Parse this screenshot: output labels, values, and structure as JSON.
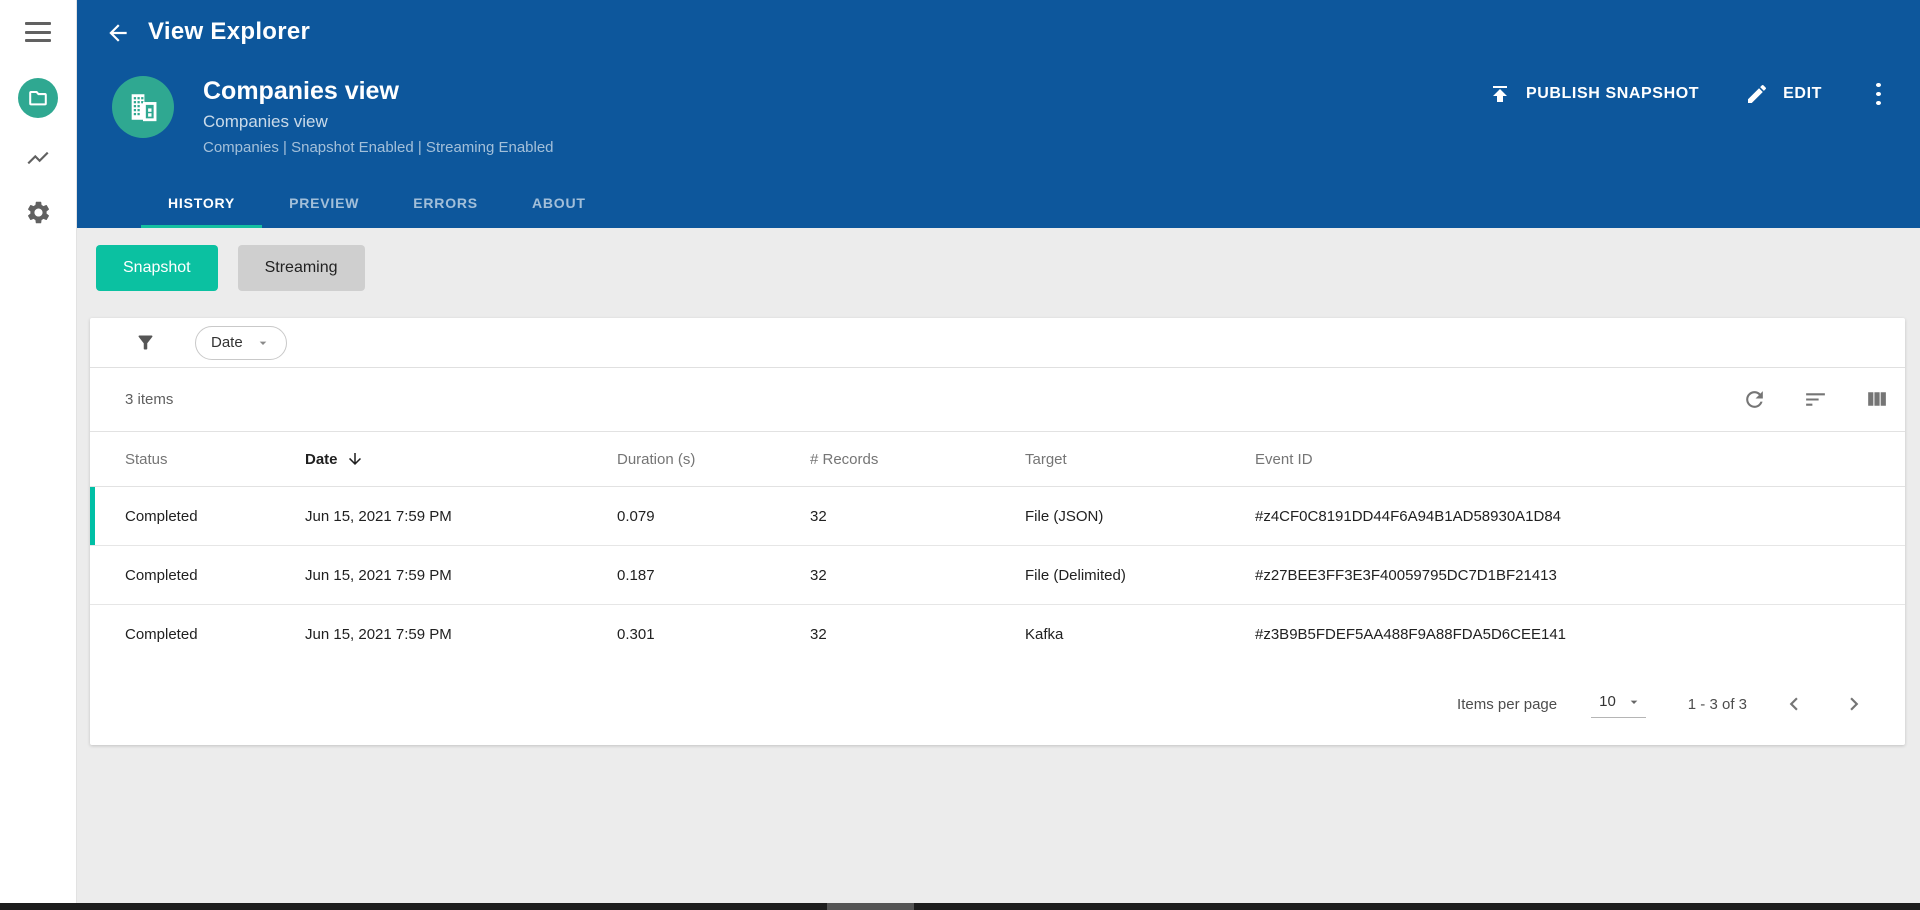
{
  "app": {
    "title": "View Explorer"
  },
  "sidebar": {
    "icons": [
      "menu-icon",
      "views-folder-icon",
      "metrics-chart-icon",
      "settings-gear-icon"
    ]
  },
  "header": {
    "title": "Companies view",
    "subtitle": "Companies view",
    "meta": "Companies | Snapshot Enabled | Streaming Enabled",
    "publish_label": "PUBLISH SNAPSHOT",
    "edit_label": "EDIT"
  },
  "tabs": [
    {
      "label": "HISTORY",
      "active": true
    },
    {
      "label": "PREVIEW",
      "active": false
    },
    {
      "label": "ERRORS",
      "active": false
    },
    {
      "label": "ABOUT",
      "active": false
    }
  ],
  "mode_toggle": {
    "snapshot_label": "Snapshot",
    "streaming_label": "Streaming",
    "active": "Snapshot"
  },
  "filter": {
    "chip_label": "Date"
  },
  "table": {
    "count_label": "3 items",
    "columns": [
      "Status",
      "Date",
      "Duration (s)",
      "# Records",
      "Target",
      "Event ID"
    ],
    "sorted_by": "Date",
    "sort_direction": "desc",
    "rows": [
      {
        "status": "Completed",
        "date": "Jun 15, 2021 7:59 PM",
        "duration": "0.079",
        "records": "32",
        "target": "File (JSON)",
        "event_id": "#z4CF0C8191DD44F6A94B1AD58930A1D84"
      },
      {
        "status": "Completed",
        "date": "Jun 15, 2021 7:59 PM",
        "duration": "0.187",
        "records": "32",
        "target": "File (Delimited)",
        "event_id": "#z27BEE3FF3E3F40059795DC7D1BF21413"
      },
      {
        "status": "Completed",
        "date": "Jun 15, 2021 7:59 PM",
        "duration": "0.301",
        "records": "32",
        "target": "Kafka",
        "event_id": "#z3B9B5FDEF5AA488F9A88FDA5D6CEE141"
      }
    ]
  },
  "pagination": {
    "items_per_page_label": "Items per page",
    "page_size": "10",
    "range_label": "1 - 3 of 3"
  },
  "colors": {
    "appbar_blue": "#0d579c",
    "accent_teal": "#00bfa5",
    "avatar_teal": "#2fa891",
    "snapshot_green": "#0bc1a1",
    "streaming_gray": "#cfcfcf",
    "content_bg": "#ececec"
  }
}
